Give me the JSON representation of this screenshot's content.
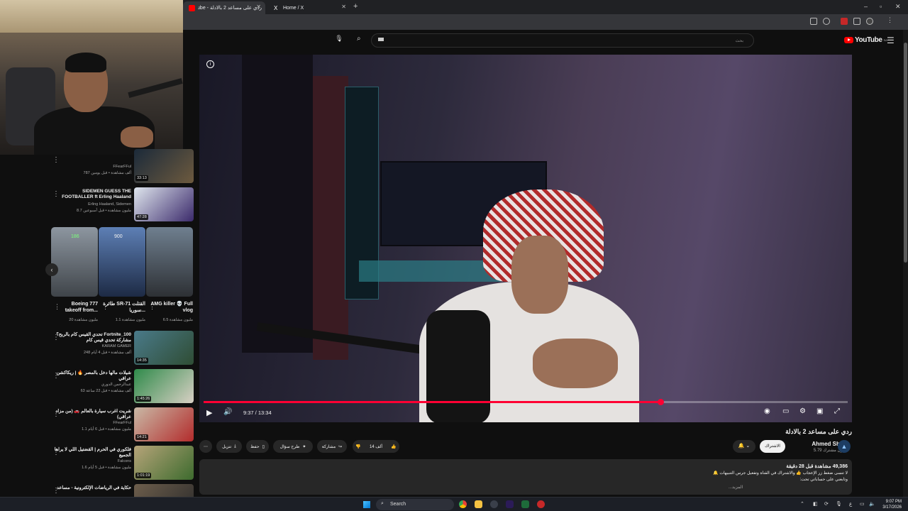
{
  "browser": {
    "tabs": [
      {
        "label": "ردي على مساعد 2 بالادلة - YouTube"
      },
      {
        "label": "Home / X"
      }
    ],
    "new_tab": "+",
    "window_controls": {
      "minimize": "–",
      "maximize": "▫",
      "close": "✕"
    }
  },
  "youtube": {
    "logo_text": "YouTube",
    "logo_region": "SA",
    "search_placeholder": "بحث"
  },
  "sidebar": {
    "videos": [
      {
        "title": "",
        "channel": "FFearFFul",
        "meta": "787 ألف مشاهدة • قبل يومين",
        "duration": "33:13"
      },
      {
        "title": "SIDEMEN GUESS THE FOOTBALLER ft Erling Haaland",
        "channel": "Erling Haaland, Sidemen",
        "meta": "8.7 مليون مشاهدة • قبل أسبوعين",
        "duration": "47:28"
      },
      {
        "title": "Fortnite_100 تحدي القيس كام بالربح؟ مشاركة تحدي قيس كام",
        "channel": "KARAM GAMER",
        "meta": "248 ألف مشاهدة • قبل 4 أيام",
        "duration": "14:35"
      },
      {
        "title": "شيلات مالها دخل بالمصر 🔥 | ريكاكشن عراقي",
        "channel": "عبدالرحمن الدوري",
        "meta": "63 ألف مشاهدة • قبل 22 ساعة",
        "duration": "1:45:26"
      },
      {
        "title": "شريت اغرب سيارة بالعالم 🚗 (من مزاد عراقي)",
        "channel": "FFearFFul",
        "meta": "1.1 مليون مشاهدة • قبل 6 أيام",
        "duration": "14:21"
      },
      {
        "title": "فلكوري في الحرم | القضتيل اللي لا يراها الجميع",
        "channel": "Falcons",
        "meta": "1.6 مليون مشاهدة • قبل 5 أيام",
        "duration": "1:01:19"
      },
      {
        "title": "حكاية في الرياضات الإلكترونية - مساعد",
        "channel": "",
        "meta": "",
        "duration": ""
      }
    ],
    "shorts": [
      {
        "title": "AMG killer 💀 Full vlog",
        "views": "6.5 مليون مشاهدة",
        "badge": ""
      },
      {
        "title": "طائرة SR-71 القتلت سوريا...",
        "views": "1.1 مليون مشاهدة",
        "badge": "900"
      },
      {
        "title": "Boeing 777 takeoff from...",
        "views": "20 مليون مشاهدة",
        "badge": "186"
      }
    ],
    "shorts_prev": "‹"
  },
  "player": {
    "time": "9:37 / 13:34",
    "progress_fraction": 0.709,
    "info_icon": "i"
  },
  "video": {
    "title": "ردي على مساعد 2 بالادلة",
    "channel": "Ahmed Show",
    "subscribers": "5.79 مليون مشترك",
    "subscribe_label": "الاشتراك",
    "likes": "14 ألف",
    "share_label": "مشاركة",
    "ask_label": "طرح سؤال",
    "save_label": "حفظ",
    "download_label": "تنزيل",
    "stats": "49,386 مشاهدة قبل 28 دقيقة",
    "desc_line1": "لا تنسى ضغط زر الإعجاب 👍 والاشتراك في القناة وتفعيل جرس التنبيهات 🔔",
    "desc_line2": "وتابعني على حساباتي تحت:",
    "more": "...المزيد"
  },
  "taskbar": {
    "search_label": "Search",
    "time": "9:07 PM",
    "date": "3/17/2026",
    "lang": "ع"
  },
  "colors": {
    "accent_red": "#ff0033",
    "background": "#0f0f0f",
    "pill": "#272727"
  }
}
